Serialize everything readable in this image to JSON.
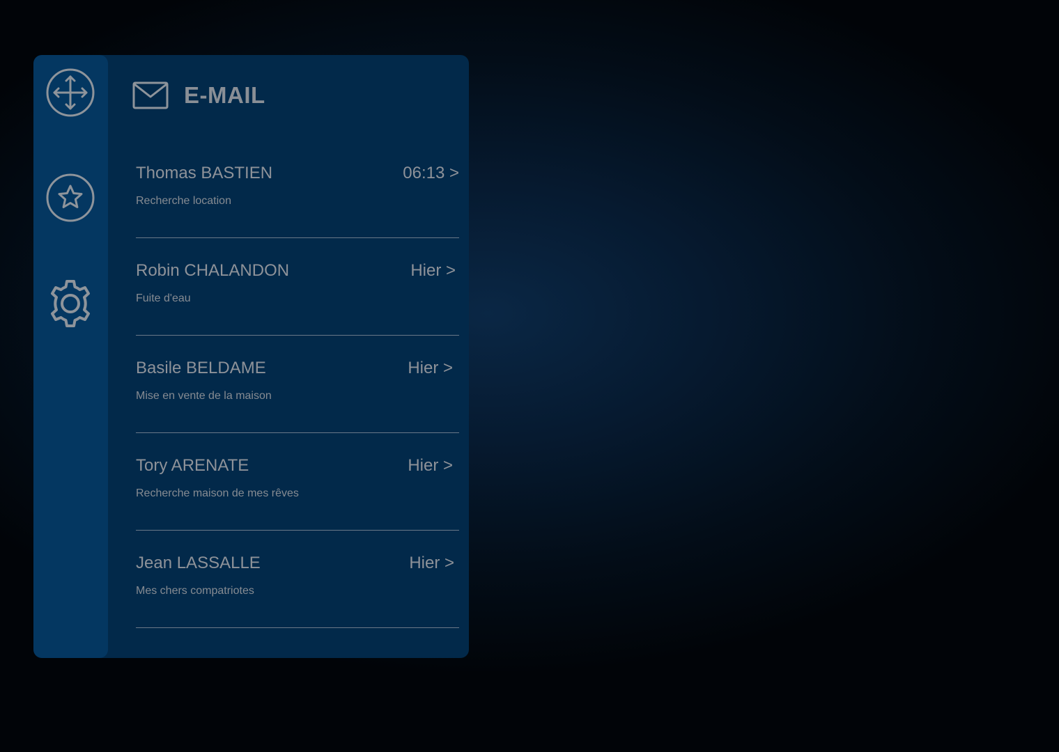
{
  "sidebar": {
    "buttons": [
      {
        "icon": "move-arrows-icon"
      },
      {
        "icon": "star-icon"
      },
      {
        "icon": "gear-icon"
      }
    ]
  },
  "header": {
    "icon": "mail-icon",
    "title": "E-MAIL"
  },
  "emails": [
    {
      "sender": "Thomas BASTIEN",
      "time": "06:13 >",
      "subject": "Recherche location"
    },
    {
      "sender": "Robin CHALANDON",
      "time": "Hier >",
      "subject": "Fuite d'eau"
    },
    {
      "sender": "Basile BELDAME",
      "time": "Hier >",
      "subject": "Mise en vente de la maison"
    },
    {
      "sender": "Tory ARENATE",
      "time": "Hier >",
      "subject": "Recherche maison de mes rêves"
    },
    {
      "sender": "Jean LASSALLE",
      "time": "Hier >",
      "subject": "Mes chers compatriotes"
    }
  ],
  "colors": {
    "panel": "#02294a",
    "sidebar": "#043761",
    "text": "#8e9299",
    "divider": "#6a7888"
  }
}
